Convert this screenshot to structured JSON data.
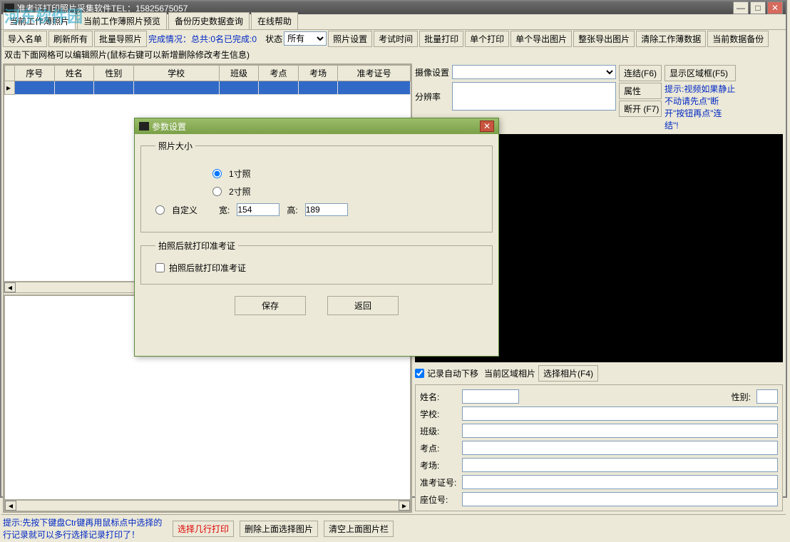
{
  "title": "准考证打印照片采集软件TEL：15825675057",
  "watermark": "河东软件园",
  "winbtns": {
    "min": "—",
    "max": "□",
    "close": "✕"
  },
  "tabs": [
    "当前工作薄照片",
    "当前工作薄照片预览",
    "备份历史数据查询",
    "在线帮助"
  ],
  "toolbar": {
    "importList": "导入名单",
    "refreshAll": "刷新所有",
    "batchShoot": "批量导照片",
    "status": "完成情况：总共:0名已完成:0",
    "stateLabel": "状态",
    "stateValue": "所有",
    "photoSettings": "照片设置",
    "examTime": "考试时间",
    "batchPrint": "批量打印",
    "singlePrint": "单个打印",
    "singleExport": "单个导出图片",
    "sheetExport": "整张导出图片",
    "clearBook": "清除工作薄数据",
    "currentBackup": "当前数据备份"
  },
  "gridHint": "双击下面网格可以编辑照片(鼠标右键可以新增删除修改考生信息)",
  "columns": [
    "序号",
    "姓名",
    "性别",
    "学校",
    "班级",
    "考点",
    "考场",
    "准考证号"
  ],
  "camera": {
    "deviceLabel": "摄像设置",
    "resLabel": "分辨率",
    "connect": "连结(F6)",
    "property": "属性",
    "disconnect": "断开 (F7)",
    "showArea": "显示区域框(F5)",
    "tip": "提示:视频如果静止不动请先点\"断开\"按钮再点\"连结\"!"
  },
  "rec": {
    "auto": "记录自动下移",
    "areaPhoto": "当前区域相片",
    "choose": "选择相片(F4)"
  },
  "fields": {
    "name": "姓名:",
    "gender": "性别:",
    "school": "学校:",
    "class": "班级:",
    "site": "考点:",
    "room": "考场:",
    "ticket": "准考证号:",
    "seat": "座位号:"
  },
  "bottom": {
    "hint": "提示:先按下键盘Ctr键再用鼠标点中选择的行记录就可以多行选择记录打印了！",
    "multiPrint": "选择几行打印",
    "delSel": "删除上面选择图片",
    "clearThumbs": "清空上面图片栏"
  },
  "dialog": {
    "title": "参数设置",
    "photoSize": "照片大小",
    "r1": "1寸照",
    "r2": "2寸照",
    "r3": "自定义",
    "wl": "宽:",
    "wv": "154",
    "hl": "高:",
    "hv": "189",
    "afterShot": "拍照后就打印准考证",
    "checkLabel": "拍照后就打印准考证",
    "save": "保存",
    "back": "返回"
  }
}
